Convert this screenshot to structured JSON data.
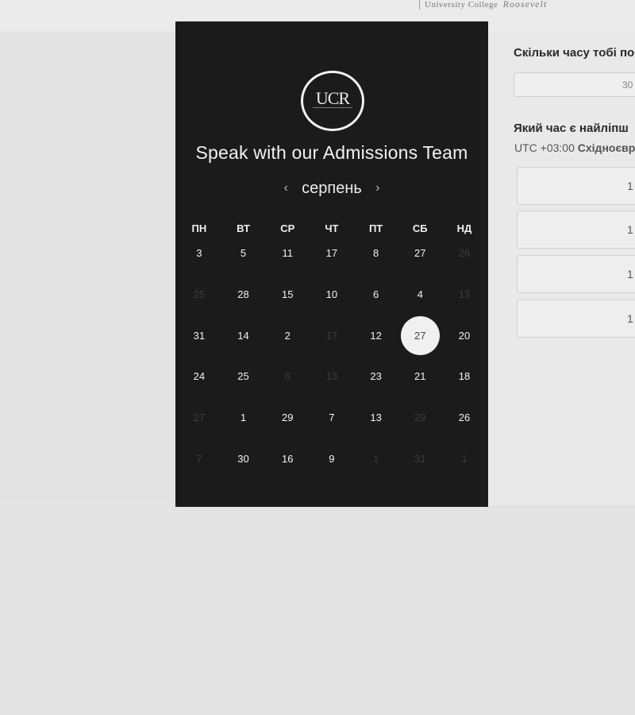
{
  "brand": {
    "left": "University College",
    "right": "Roosevelt"
  },
  "panel": {
    "logo_text": "UCR",
    "title": "Speak with our Admissions Team",
    "month": "серпень",
    "prev_arrow": "‹",
    "next_arrow": "›",
    "weekdays": [
      "ПН",
      "ВТ",
      "СР",
      "ЧТ",
      "ПТ",
      "СБ",
      "НД"
    ],
    "days": [
      {
        "label": "3",
        "state": "active"
      },
      {
        "label": "5",
        "state": "active"
      },
      {
        "label": "11",
        "state": "active"
      },
      {
        "label": "17",
        "state": "active"
      },
      {
        "label": "8",
        "state": "active"
      },
      {
        "label": "27",
        "state": "active"
      },
      {
        "label": "26",
        "state": "disabled"
      },
      {
        "label": "25",
        "state": "disabled"
      },
      {
        "label": "28",
        "state": "active"
      },
      {
        "label": "15",
        "state": "active"
      },
      {
        "label": "10",
        "state": "active"
      },
      {
        "label": "6",
        "state": "active"
      },
      {
        "label": "4",
        "state": "active"
      },
      {
        "label": "13",
        "state": "disabled"
      },
      {
        "label": "31",
        "state": "active"
      },
      {
        "label": "14",
        "state": "active"
      },
      {
        "label": "2",
        "state": "active"
      },
      {
        "label": "17",
        "state": "disabled"
      },
      {
        "label": "12",
        "state": "active"
      },
      {
        "label": "27",
        "state": "selected"
      },
      {
        "label": "20",
        "state": "active"
      },
      {
        "label": "24",
        "state": "active"
      },
      {
        "label": "25",
        "state": "active"
      },
      {
        "label": "6",
        "state": "disabled"
      },
      {
        "label": "13",
        "state": "disabled"
      },
      {
        "label": "23",
        "state": "active"
      },
      {
        "label": "21",
        "state": "active"
      },
      {
        "label": "18",
        "state": "active"
      },
      {
        "label": "27",
        "state": "disabled"
      },
      {
        "label": "1",
        "state": "active"
      },
      {
        "label": "29",
        "state": "active"
      },
      {
        "label": "7",
        "state": "active"
      },
      {
        "label": "13",
        "state": "active"
      },
      {
        "label": "29",
        "state": "disabled"
      },
      {
        "label": "26",
        "state": "active"
      },
      {
        "label": "7",
        "state": "disabled"
      },
      {
        "label": "30",
        "state": "active"
      },
      {
        "label": "16",
        "state": "active"
      },
      {
        "label": "9",
        "state": "active"
      },
      {
        "label": "1",
        "state": "disabled"
      },
      {
        "label": "31",
        "state": "disabled"
      },
      {
        "label": "1",
        "state": "disabled"
      }
    ]
  },
  "right": {
    "duration_question": "Скільки часу тобі по",
    "duration_value": "30",
    "time_question": "Який час є найліпш",
    "timezone_prefix": "UTC +03:00 ",
    "timezone_name": "Східноєвр",
    "slots": [
      "1",
      "1",
      "1",
      "1"
    ]
  },
  "colors": {
    "panel_bg": "#1b1b1b",
    "page_bg": "#e4e4e4",
    "selected_day_bg": "#f0f0f0",
    "disabled_day": "#3d3d3d"
  }
}
